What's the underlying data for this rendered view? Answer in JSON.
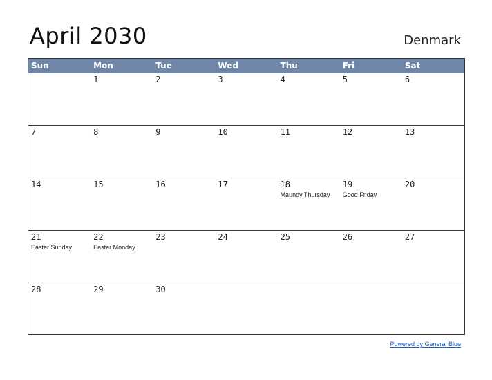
{
  "title": "April 2030",
  "country": "Denmark",
  "footer_link": "Powered by General Blue",
  "colors": {
    "header_bg": "#6f86a8",
    "link": "#1a5fc8"
  },
  "weekdays": [
    "Sun",
    "Mon",
    "Tue",
    "Wed",
    "Thu",
    "Fri",
    "Sat"
  ],
  "weeks": [
    [
      {
        "day": ""
      },
      {
        "day": "1"
      },
      {
        "day": "2"
      },
      {
        "day": "3"
      },
      {
        "day": "4"
      },
      {
        "day": "5"
      },
      {
        "day": "6"
      }
    ],
    [
      {
        "day": "7"
      },
      {
        "day": "8"
      },
      {
        "day": "9"
      },
      {
        "day": "10"
      },
      {
        "day": "11"
      },
      {
        "day": "12"
      },
      {
        "day": "13"
      }
    ],
    [
      {
        "day": "14"
      },
      {
        "day": "15"
      },
      {
        "day": "16"
      },
      {
        "day": "17"
      },
      {
        "day": "18",
        "holiday": "Maundy Thursday"
      },
      {
        "day": "19",
        "holiday": "Good Friday"
      },
      {
        "day": "20"
      }
    ],
    [
      {
        "day": "21",
        "holiday": "Easter Sunday"
      },
      {
        "day": "22",
        "holiday": "Easter Monday"
      },
      {
        "day": "23"
      },
      {
        "day": "24"
      },
      {
        "day": "25"
      },
      {
        "day": "26"
      },
      {
        "day": "27"
      }
    ],
    [
      {
        "day": "28"
      },
      {
        "day": "29"
      },
      {
        "day": "30"
      },
      {
        "day": ""
      },
      {
        "day": ""
      },
      {
        "day": ""
      },
      {
        "day": ""
      }
    ]
  ]
}
